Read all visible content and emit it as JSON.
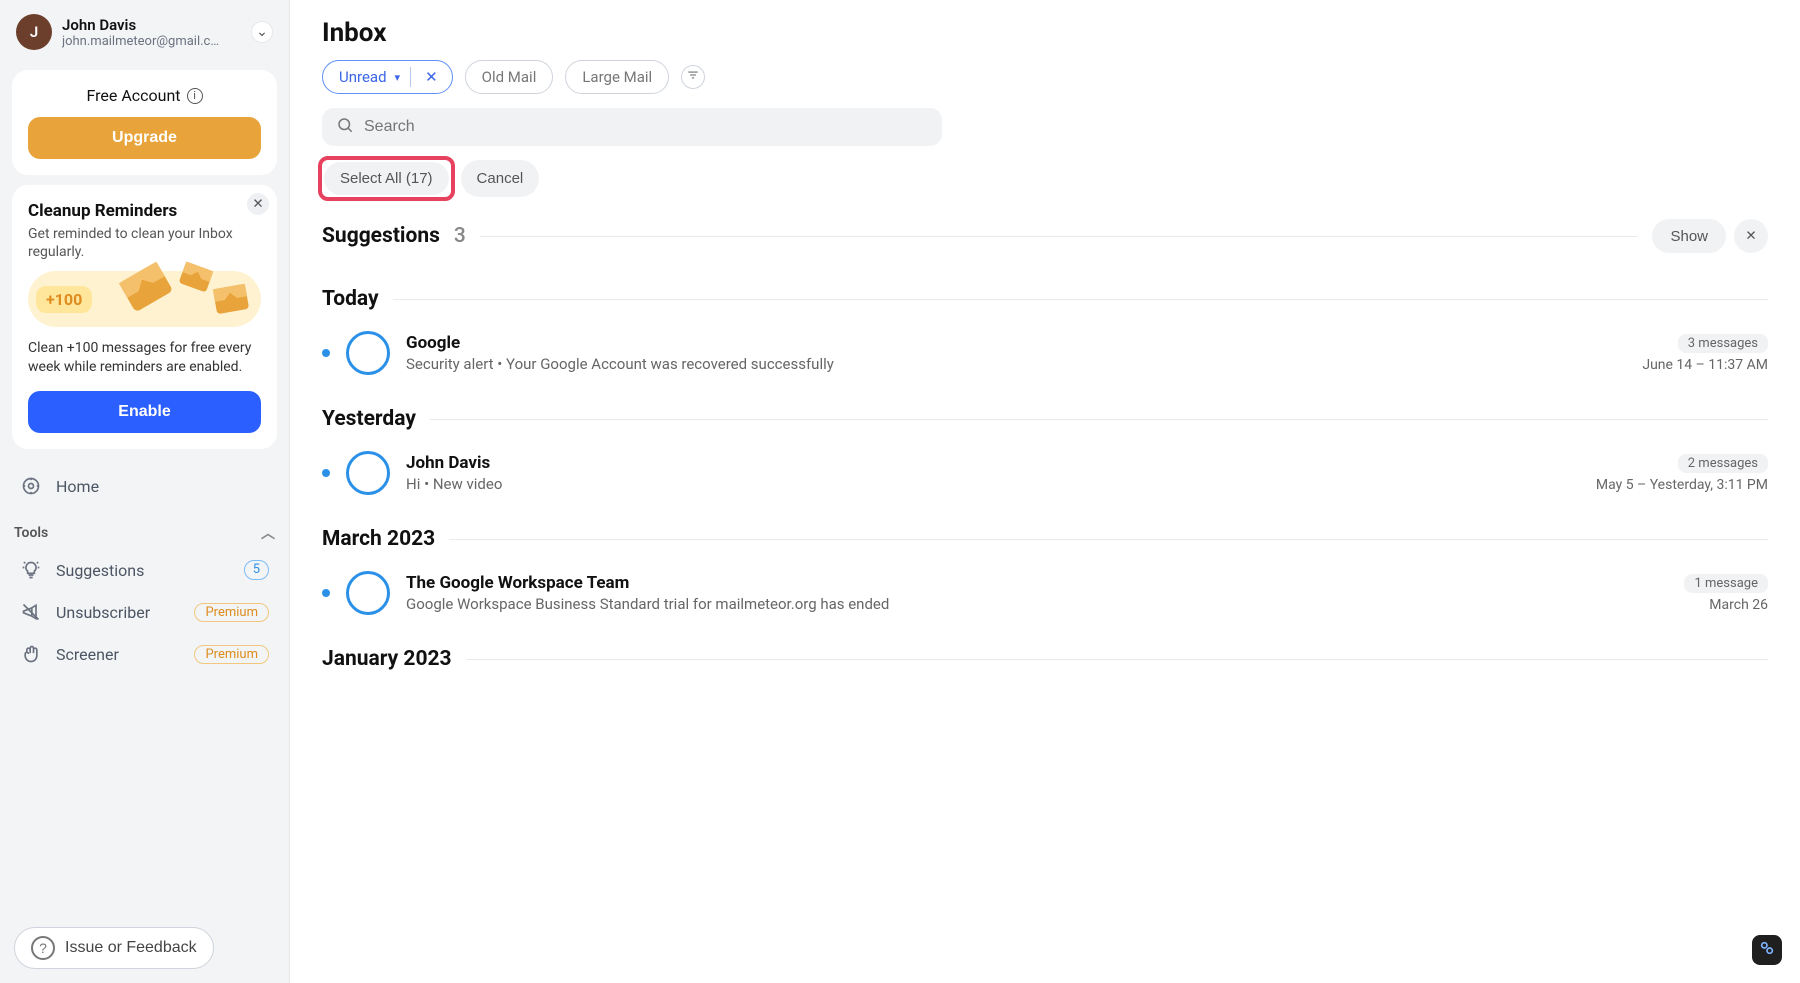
{
  "account": {
    "initial": "J",
    "name": "John Davis",
    "email": "john.mailmeteor@gmail.c…"
  },
  "plan": {
    "label": "Free Account",
    "cta": "Upgrade"
  },
  "cleanup": {
    "title": "Cleanup Reminders",
    "subtitle": "Get reminded to clean your Inbox regularly.",
    "bonus": "+100",
    "body": "Clean +100 messages for free every week while reminders are enabled.",
    "cta": "Enable"
  },
  "nav": {
    "home": "Home",
    "tools_header": "Tools",
    "suggestions": {
      "label": "Suggestions",
      "count": "5"
    },
    "unsubscriber": {
      "label": "Unsubscriber",
      "badge": "Premium"
    },
    "screener": {
      "label": "Screener",
      "badge": "Premium"
    }
  },
  "feedback": "Issue or Feedback",
  "header": {
    "title": "Inbox"
  },
  "filters": {
    "active": "Unread",
    "chip_old": "Old Mail",
    "chip_large": "Large Mail"
  },
  "search": {
    "placeholder": "Search"
  },
  "select": {
    "all": "Select All (17)",
    "cancel": "Cancel"
  },
  "sections": {
    "suggestions": {
      "title": "Suggestions",
      "count": "3",
      "show": "Show"
    },
    "today": "Today",
    "yesterday": "Yesterday",
    "march": "March 2023",
    "january": "January 2023"
  },
  "emails": {
    "today": {
      "sender": "Google",
      "preview": "Security alert • Your Google Account was recovered successfully",
      "count": "3 messages",
      "date": "June 14 – 11:37 AM"
    },
    "yesterday": {
      "sender": "John Davis",
      "preview": "Hi • New video",
      "count": "2 messages",
      "date": "May 5 – Yesterday, 3:11 PM"
    },
    "march": {
      "sender": "The Google Workspace Team",
      "preview": "Google Workspace Business Standard trial for mailmeteor.org has ended",
      "count": "1 message",
      "date": "March 26"
    }
  }
}
